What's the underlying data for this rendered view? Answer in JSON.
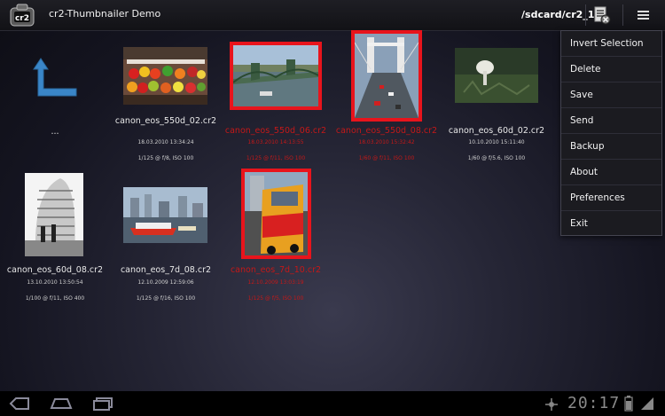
{
  "header": {
    "app_icon_text": "cr2",
    "title": "cr2-Thumbnailer Demo",
    "path": "/sdcard/cr2_1"
  },
  "up_item": {
    "label": "..."
  },
  "items": [
    {
      "name": "canon_eos_550d_02.cr2",
      "date": "18.03.2010 13:34:24",
      "exif": "1/125 @ f/8, ISO 100",
      "selected": false
    },
    {
      "name": "canon_eos_550d_06.cr2",
      "date": "18.03.2010 14:13:55",
      "exif": "1/125 @ f/11, ISO 100",
      "selected": true
    },
    {
      "name": "canon_eos_550d_08.cr2",
      "date": "18.03.2010 15:32:42",
      "exif": "1/60 @ f/11, ISO 100",
      "selected": true
    },
    {
      "name": "canon_eos_60d_02.cr2",
      "date": "10.10.2010 15:11:40",
      "exif": "1/60 @ f/5.6, ISO 100",
      "selected": false
    },
    {
      "name": "canon_eos_60d_08.cr2",
      "date": "13.10.2010 13:50:54",
      "exif": "1/100 @ f/11, ISO 400",
      "selected": false
    },
    {
      "name": "canon_eos_7d_08.cr2",
      "date": "12.10.2009 12:59:06",
      "exif": "1/125 @ f/16, ISO 100",
      "selected": false
    },
    {
      "name": "canon_eos_7d_10.cr2",
      "date": "12.10.2009 13:03:19",
      "exif": "1/125 @ f/5, ISO 100",
      "selected": true
    }
  ],
  "menu": {
    "items": [
      "Invert Selection",
      "Delete",
      "Save",
      "Send",
      "Backup",
      "About",
      "Preferences",
      "Exit"
    ]
  },
  "status": {
    "time": "20:17"
  },
  "colors": {
    "selection": "#e8141c",
    "background": "#1d1d2a",
    "selected_text": "#c41818"
  }
}
